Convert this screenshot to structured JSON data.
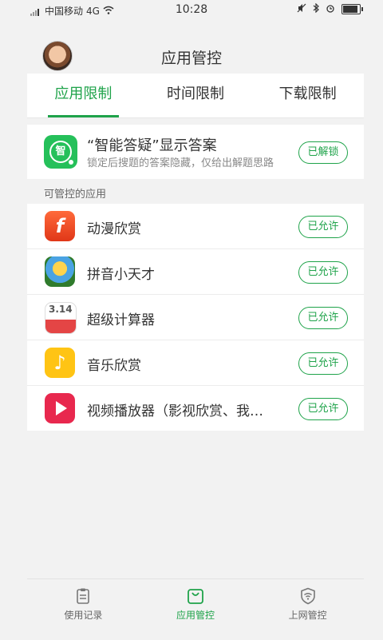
{
  "status": {
    "carrier": "中国移动",
    "network": "4G",
    "time": "10:28",
    "battery_level": 0.8
  },
  "header": {
    "title": "应用管控"
  },
  "tabs": [
    {
      "label": "应用限制",
      "active": true
    },
    {
      "label": "时间限制",
      "active": false
    },
    {
      "label": "下载限制",
      "active": false
    }
  ],
  "qa": {
    "title": "“智能答疑”显示答案",
    "description": "锁定后搜题的答案隐藏，仅给出解题思路",
    "icon_text": "智",
    "action": "已解锁"
  },
  "section_label": "可管控的应用",
  "apps": [
    {
      "name": "动漫欣赏",
      "icon": "flash-icon",
      "action": "已允许"
    },
    {
      "name": "拼音小天才",
      "icon": "pinyin-icon",
      "action": "已允许"
    },
    {
      "name": "超级计算器",
      "icon": "calculator-icon",
      "icon_text": "3.14",
      "action": "已允许"
    },
    {
      "name": "音乐欣赏",
      "icon": "music-note-icon",
      "action": "已允许"
    },
    {
      "name": "视频播放器（影视欣赏、我…",
      "icon": "video-play-icon",
      "action": "已允许"
    }
  ],
  "bottom_nav": [
    {
      "label": "使用记录",
      "icon": "clipboard-icon",
      "active": false
    },
    {
      "label": "应用管控",
      "icon": "bag-icon",
      "active": true
    },
    {
      "label": "上网管控",
      "icon": "shield-wifi-icon",
      "active": false
    }
  ],
  "colors": {
    "accent": "#1fa34a",
    "background": "#f2f2f2"
  }
}
